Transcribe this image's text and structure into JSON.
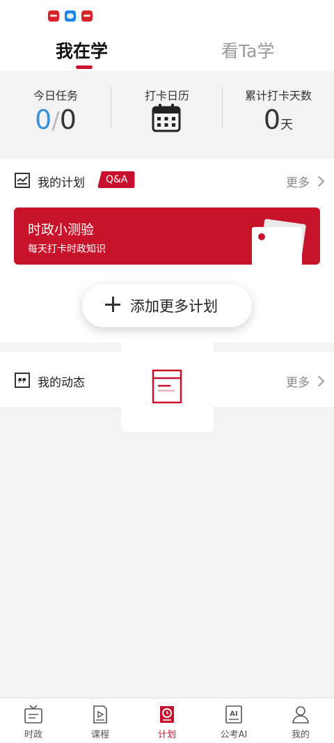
{
  "tabs": {
    "active": "我在学",
    "inactive": "看Ta学"
  },
  "stats": {
    "today_task_label": "今日任务",
    "today_done": "0",
    "today_sep": "/",
    "today_total": "0",
    "checkin_calendar_label": "打卡日历",
    "total_days_label": "累计打卡天数",
    "total_days_value": "0",
    "total_days_unit": "天"
  },
  "plan": {
    "title": "我的计划",
    "badge": "Q&A",
    "more": "更多",
    "card_title": "时政小测验",
    "card_subtitle": "每天打卡时政知识",
    "add_label": "添加更多计划"
  },
  "feed": {
    "title": "我的动态",
    "more": "更多"
  },
  "nav": [
    {
      "label": "时政",
      "icon": "news-tv-icon"
    },
    {
      "label": "课程",
      "icon": "course-book-icon"
    },
    {
      "label": "计划",
      "icon": "plan-clock-icon"
    },
    {
      "label": "公考AI",
      "icon": "ai-book-icon"
    },
    {
      "label": "我的",
      "icon": "user-icon"
    }
  ],
  "colors": {
    "accent": "#c8102e",
    "blue": "#3b8fd8"
  }
}
